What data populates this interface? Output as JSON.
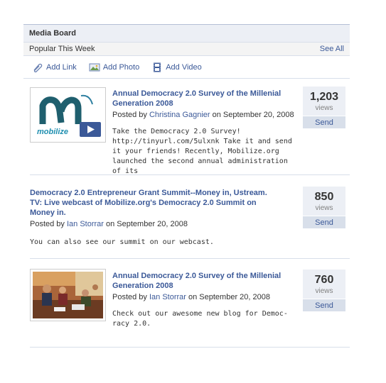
{
  "board": {
    "title": "Media Board",
    "popular_label": "Popular This Week",
    "see_all": "See All",
    "actions": {
      "add_link": "Add Link",
      "add_photo": "Add Photo",
      "add_video": "Add Video"
    }
  },
  "items": [
    {
      "title": "Annual Democracy 2.0 Survey of the Millenial Generation 2008",
      "posted_by": "Posted by",
      "author": "Christina Gagnier",
      "date": "on September 20, 2008",
      "description": "Take the Democracy 2.0 Survey! http://tinyurl.com/5ulxnk Take it and send it your friends! Recently, Mobilize.org launched the second annual administration of its",
      "views": "1,203",
      "views_label": "views",
      "send": "Send",
      "thumb_text": "mobilize"
    },
    {
      "title": "Democracy 2.0 Entrepreneur Grant Summit--Money in, Ustream. TV: Live webcast of Mobilize.org's Democracy 2.0 Summit on Money in.",
      "posted_by": "Posted by",
      "author": "Ian Storrar",
      "date": "on September 20, 2008",
      "description": "You can also see our summit on our webcast.",
      "views": "850",
      "views_label": "views",
      "send": "Send"
    },
    {
      "title": "Annual Democracy 2.0 Survey of the Millenial Generation 2008",
      "posted_by": "Posted by",
      "author": "Ian Storrar",
      "date": "on September 20, 2008",
      "description": "Check out our awesome new blog for Democ- racy 2.0.",
      "views": "760",
      "views_label": "views",
      "send": "Send"
    }
  ],
  "colors": {
    "link": "#3b5998",
    "header_bg": "#eceff5",
    "send_bg": "#d8dfea"
  }
}
